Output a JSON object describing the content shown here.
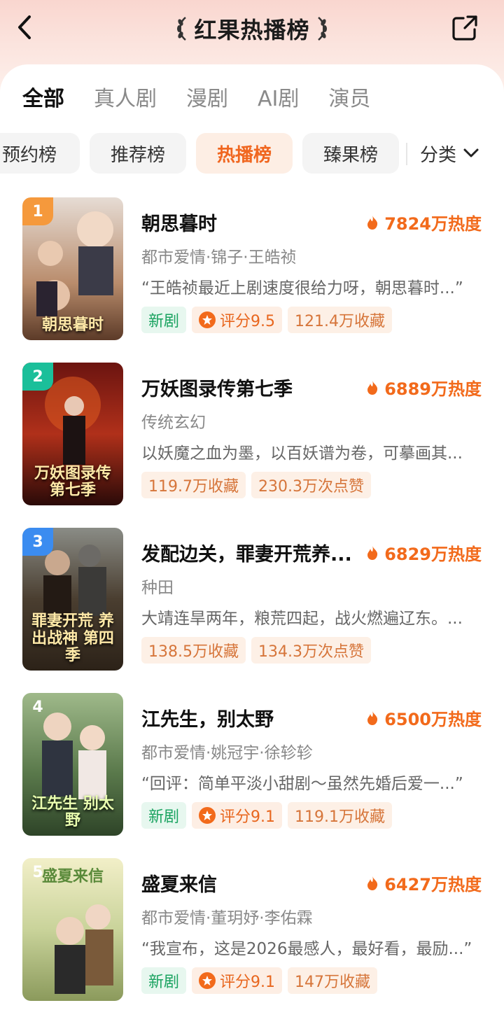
{
  "header": {
    "title": "红果热播榜"
  },
  "tabs": [
    "全部",
    "真人剧",
    "漫剧",
    "AI剧",
    "演员"
  ],
  "chips": [
    "预约榜",
    "推荐榜",
    "热播榜",
    "臻果榜"
  ],
  "category_label": "分类",
  "items": [
    {
      "rank": "1",
      "title": "朝思暮时",
      "heat": "7824万热度",
      "meta": "都市爱情·锦子·王皓祯",
      "desc": "“王皓祯最近上剧速度很给力呀，朝思暮时...”",
      "poster_text": "朝思暮时",
      "tags": [
        {
          "type": "new",
          "text": "新剧"
        },
        {
          "type": "score",
          "text": "评分9.5"
        },
        {
          "type": "plain",
          "text": "121.4万收藏"
        }
      ]
    },
    {
      "rank": "2",
      "title": "万妖图录传第七季",
      "heat": "6889万热度",
      "meta": "传统玄幻",
      "desc": "以妖魔之血为墨，以百妖谱为卷，可摹画其...",
      "poster_text": "万妖图录传 第七季",
      "tags": [
        {
          "type": "plain",
          "text": "119.7万收藏"
        },
        {
          "type": "plain",
          "text": "230.3万次点赞"
        }
      ]
    },
    {
      "rank": "3",
      "title": "发配边关，罪妻开荒养...",
      "heat": "6829万热度",
      "meta": "种田",
      "desc": "大靖连旱两年，粮荒四起，战火燃遍辽东。...",
      "poster_text": "罪妻开荒 养出战神 第四季",
      "tags": [
        {
          "type": "plain",
          "text": "138.5万收藏"
        },
        {
          "type": "plain",
          "text": "134.3万次点赞"
        }
      ]
    },
    {
      "rank": "4",
      "title": "江先生，别太野",
      "heat": "6500万热度",
      "meta": "都市爱情·姚冠宇·徐轸轸",
      "desc": "“回评：简单平淡小甜剧～虽然先婚后爱一...”",
      "poster_text": "江先生 别太野",
      "tags": [
        {
          "type": "new",
          "text": "新剧"
        },
        {
          "type": "score",
          "text": "评分9.1"
        },
        {
          "type": "plain",
          "text": "119.1万收藏"
        }
      ]
    },
    {
      "rank": "5",
      "title": "盛夏来信",
      "heat": "6427万热度",
      "meta": "都市爱情·董玥妤·李佑霖",
      "desc": "“我宣布，这是2026最感人，最好看，最励...”",
      "poster_text": "盛夏来信",
      "tags": [
        {
          "type": "new",
          "text": "新剧"
        },
        {
          "type": "score",
          "text": "评分9.1"
        },
        {
          "type": "plain",
          "text": "147万收藏"
        }
      ]
    }
  ]
}
